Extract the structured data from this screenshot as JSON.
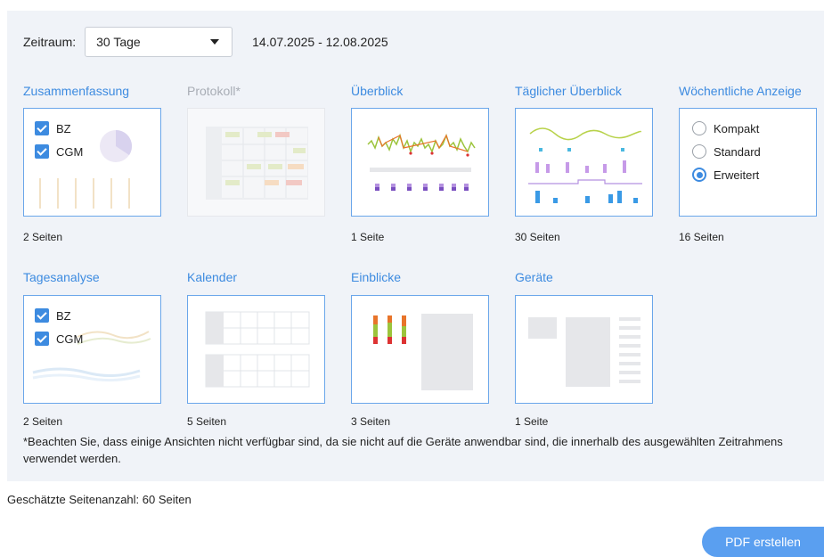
{
  "period": {
    "label": "Zeitraum:",
    "selected": "30 Tage",
    "date_range": "14.07.2025 - 12.08.2025"
  },
  "reports": [
    {
      "title": "Zusammenfassung",
      "pages": "2 Seiten",
      "options": [
        "BZ",
        "CGM"
      ]
    },
    {
      "title": "Protokoll*",
      "pages": ""
    },
    {
      "title": "Überblick",
      "pages": "1 Seite"
    },
    {
      "title": "Täglicher Überblick",
      "pages": "30 Seiten"
    },
    {
      "title": "Wöchentliche Anzeige",
      "pages": "16 Seiten",
      "radio_options": [
        "Kompakt",
        "Standard",
        "Erweitert"
      ],
      "selected": "Erweitert"
    },
    {
      "title": "Tagesanalyse",
      "pages": "2 Seiten",
      "options": [
        "BZ",
        "CGM"
      ]
    },
    {
      "title": "Kalender",
      "pages": "5 Seiten"
    },
    {
      "title": "Einblicke",
      "pages": "3 Seiten"
    },
    {
      "title": "Geräte",
      "pages": "1 Seite"
    }
  ],
  "note": "*Beachten Sie, dass einige Ansichten nicht verfügbar sind, da sie nicht auf die Geräte anwendbar sind, die innerhalb des ausgewählten Zeitrahmens verwendet werden.",
  "estimate": "Geschätzte Seitenanzahl: 60 Seiten",
  "pdf_button": "PDF erstellen",
  "colors": {
    "accent": "#3d8be0",
    "button": "#5a9ff0",
    "panel": "#f0f3f8",
    "disabled": "#a8adb5"
  }
}
